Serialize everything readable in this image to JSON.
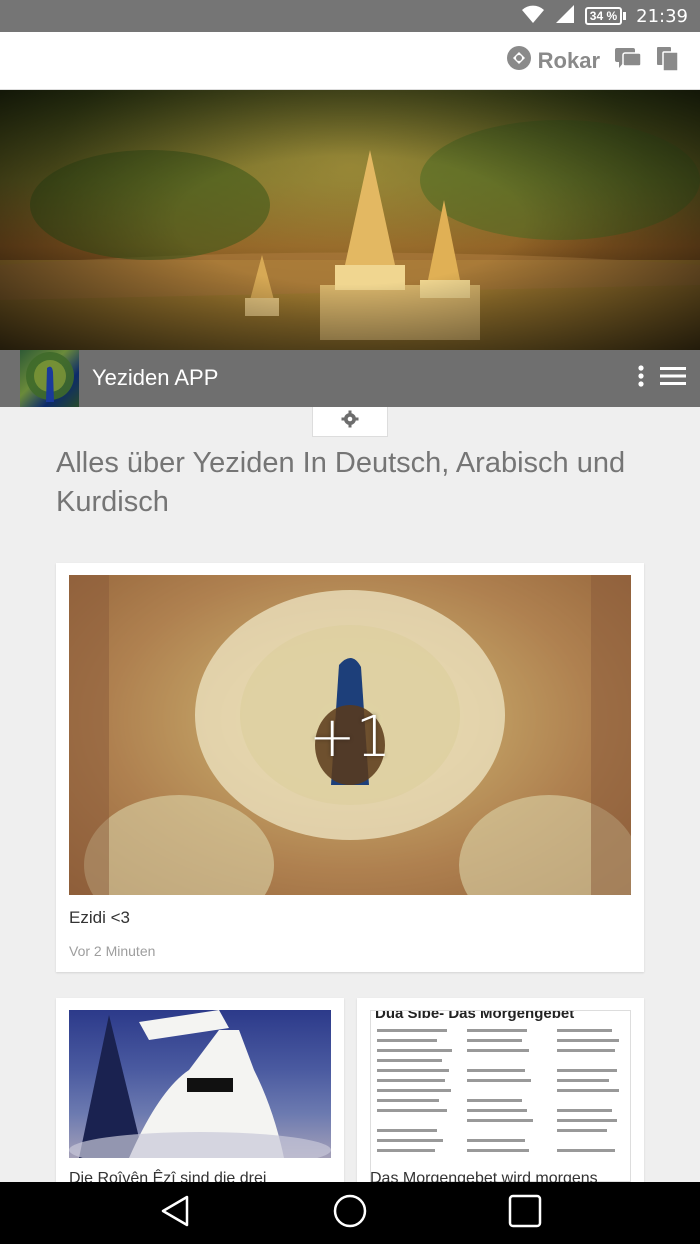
{
  "status_bar": {
    "battery": "34 %",
    "time": "21:39"
  },
  "app_bar": {
    "rokar_label": "Rokar"
  },
  "title_bar": {
    "app_name": "Yeziden APP"
  },
  "headline": "Alles über Yeziden In Deutsch, Arabisch und Kurdisch",
  "main_post": {
    "overlay": "+1",
    "caption": "Ezidi <3",
    "time": "Vor 2 Minuten"
  },
  "post_2": {
    "caption": "Die Roîvên Êzî sind die drei"
  },
  "post_3": {
    "doc_title": "Dua Sibe- Das Morgengebet",
    "caption": "Das Morgengebet wird morgens"
  }
}
